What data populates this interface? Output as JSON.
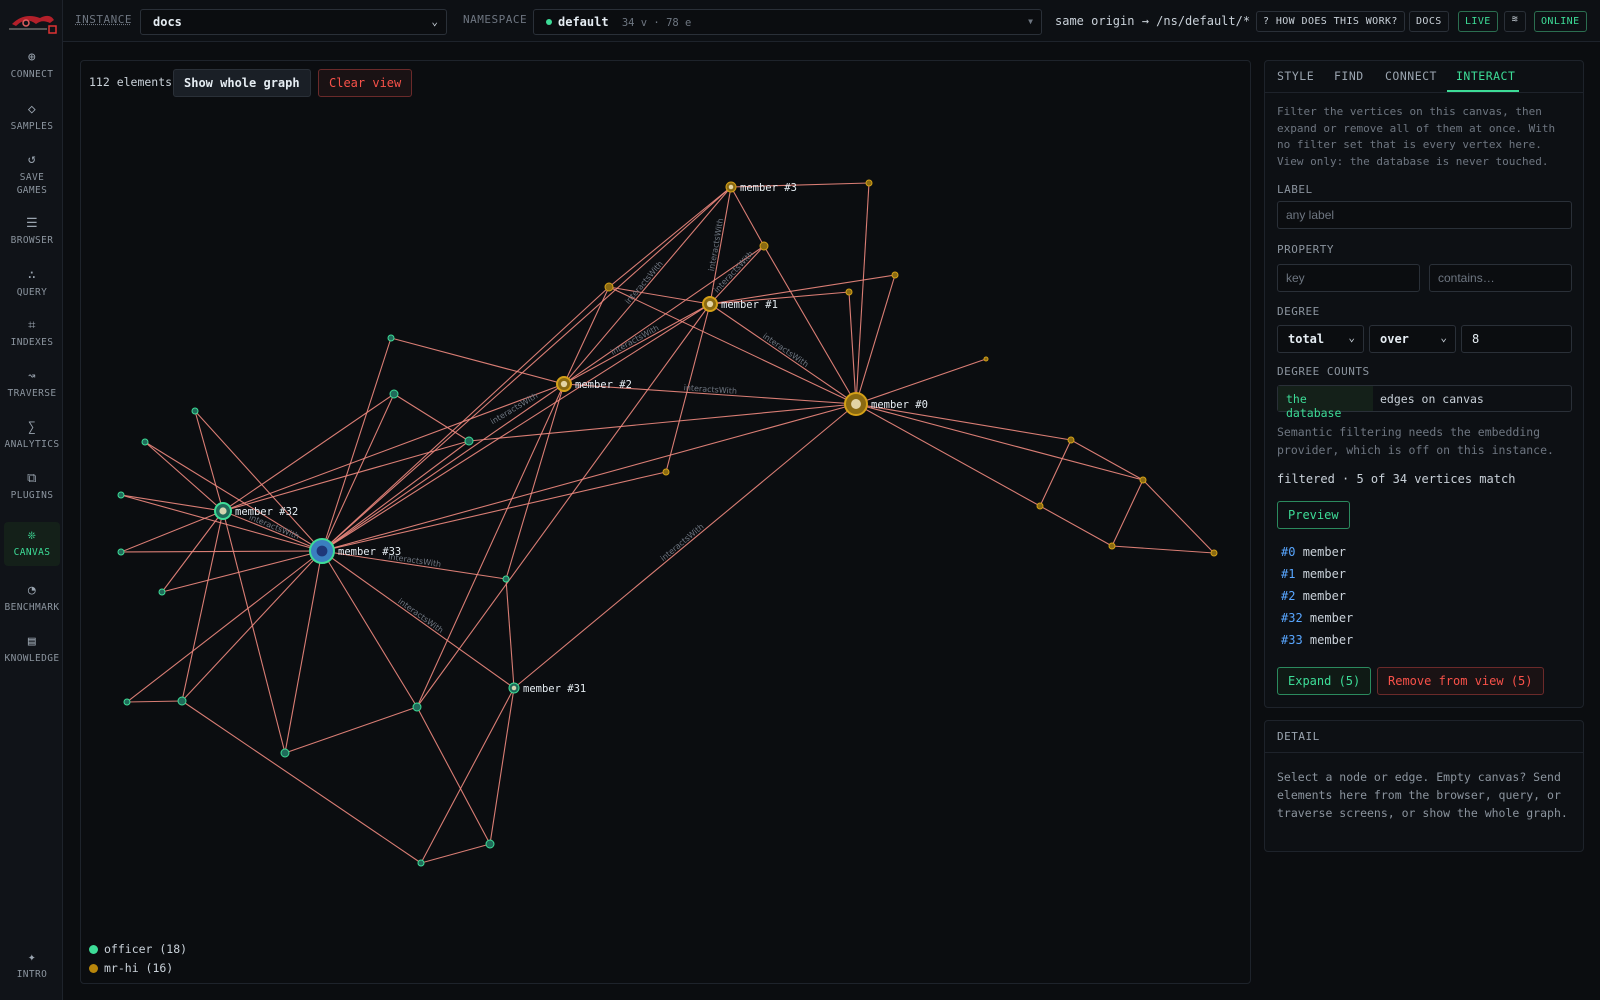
{
  "topbar": {
    "instance_label": "INSTANCE",
    "instance_value": "docs",
    "namespace_label": "NAMESPACE",
    "namespace_value": "default",
    "namespace_meta": "34 v · 78 e",
    "route": "same origin → /ns/default/*",
    "how_label": "? HOW DOES THIS WORK?",
    "docs_label": "DOCS",
    "live_label": "LIVE",
    "online_label": "ONLINE"
  },
  "sidebar": {
    "items": [
      {
        "icon": "connect-icon",
        "glyph": "⊕",
        "label": "CONNECT"
      },
      {
        "icon": "samples-icon",
        "glyph": "◇",
        "label": "SAMPLES"
      },
      {
        "icon": "save-games-icon",
        "glyph": "↺",
        "label": "SAVE GAMES"
      },
      {
        "icon": "browser-icon",
        "glyph": "☰",
        "label": "BROWSER"
      },
      {
        "icon": "query-icon",
        "glyph": "∴",
        "label": "QUERY"
      },
      {
        "icon": "indexes-icon",
        "glyph": "⌗",
        "label": "INDEXES"
      },
      {
        "icon": "traverse-icon",
        "glyph": "↝",
        "label": "TRAVERSE"
      },
      {
        "icon": "analytics-icon",
        "glyph": "∑",
        "label": "ANALYTICS"
      },
      {
        "icon": "plugins-icon",
        "glyph": "⧉",
        "label": "PLUGINS"
      },
      {
        "icon": "canvas-icon",
        "glyph": "❊",
        "label": "CANVAS"
      },
      {
        "icon": "benchmark-icon",
        "glyph": "◔",
        "label": "BENCHMARK"
      },
      {
        "icon": "knowledge-icon",
        "glyph": "▤",
        "label": "KNOWLEDGE"
      }
    ],
    "intro": {
      "icon": "intro-icon",
      "glyph": "✦",
      "label": "INTRO"
    }
  },
  "canvas": {
    "count": "112 elements",
    "show_whole_graph": "Show whole graph",
    "clear_view": "Clear view",
    "edge_label": "interactsWith",
    "legend": [
      {
        "label": "officer (18)",
        "color": "#3ddc97"
      },
      {
        "label": "mr-hi (16)",
        "color": "#b8860b"
      }
    ],
    "node_labels": {
      "member0": "member #0",
      "member1": "member #1",
      "member2": "member #2",
      "member3": "member #3",
      "member31": "member #31",
      "member32": "member #32",
      "member33": "member #33"
    }
  },
  "panel": {
    "tabs": [
      "STYLE",
      "FIND",
      "CONNECT",
      "INTERACT"
    ],
    "intro": "Filter the vertices on this canvas, then expand or remove all of them at once. With no filter set that is every vertex here. View only: the database is never touched.",
    "label_title": "LABEL",
    "label_placeholder": "any label",
    "property_title": "PROPERTY",
    "key_placeholder": "key",
    "contains_placeholder": "contains…",
    "degree_title": "DEGREE",
    "degree_type": "total",
    "degree_op": "over",
    "degree_value": "8",
    "degree_counts_title": "DEGREE COUNTS",
    "degree_counts_db": "the database",
    "degree_counts_canvas": "edges on canvas",
    "semantic_note": "Semantic filtering needs the embedding provider, which is off on this instance.",
    "filtered": "filtered · 5 of 34 vertices match",
    "preview": "Preview",
    "matches": [
      {
        "id": "#0",
        "label": "member"
      },
      {
        "id": "#1",
        "label": "member"
      },
      {
        "id": "#2",
        "label": "member"
      },
      {
        "id": "#32",
        "label": "member"
      },
      {
        "id": "#33",
        "label": "member"
      }
    ],
    "expand": "Expand (5)",
    "remove": "Remove from view (5)"
  },
  "detail": {
    "title": "DETAIL",
    "text": "Select a node or edge. Empty canvas? Send elements here from the browser, query, or traverse screens, or show the whole graph."
  },
  "colors": {
    "accent": "#3ddc97",
    "danger": "#f85149",
    "edge": "#f08a80",
    "officer": "#3ddc97",
    "mrhi": "#b8860b"
  }
}
